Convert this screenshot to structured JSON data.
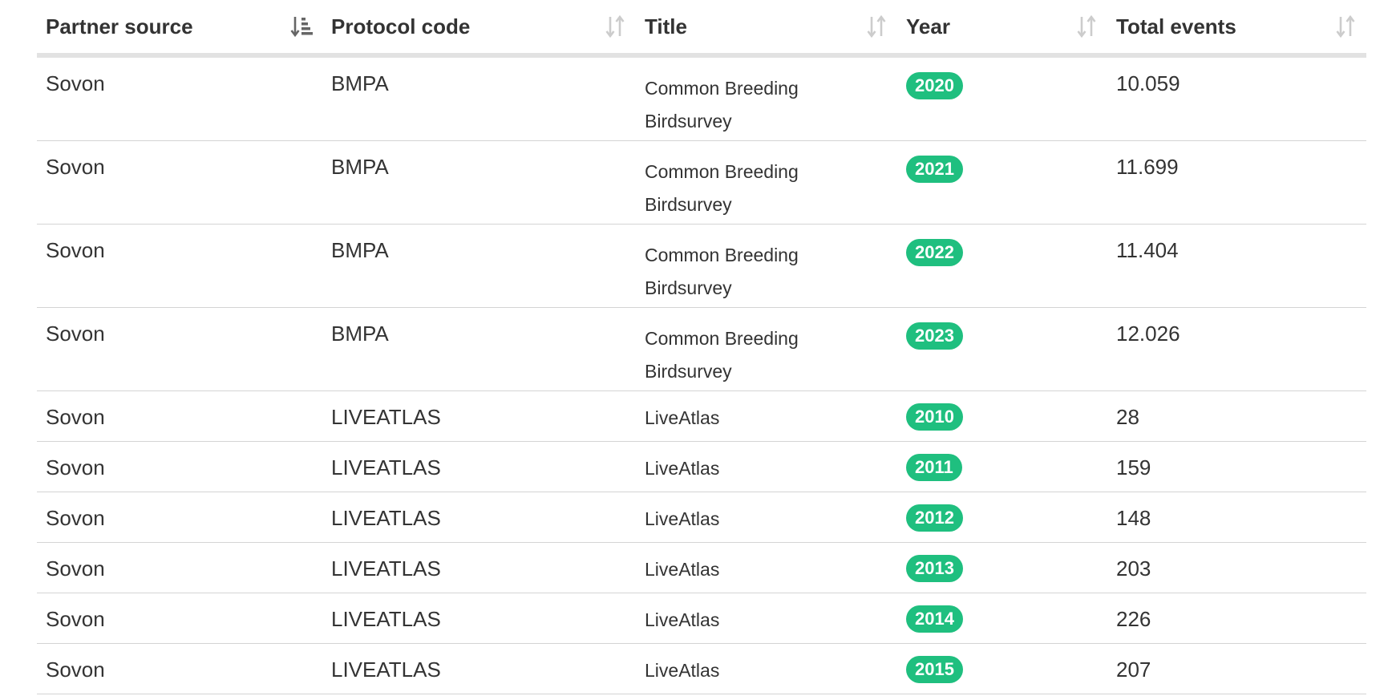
{
  "table": {
    "headers": [
      {
        "label": "Partner source",
        "sort": "active-sorted"
      },
      {
        "label": "Protocol code",
        "sort": "unsorted"
      },
      {
        "label": "Title",
        "sort": "unsorted"
      },
      {
        "label": "Year",
        "sort": "unsorted"
      },
      {
        "label": "Total events",
        "sort": "unsorted"
      }
    ],
    "rows": [
      {
        "partner": "Sovon",
        "protocol": "BMPA",
        "title": "Common Breeding Birdsurvey",
        "year": "2020",
        "events": "10.059"
      },
      {
        "partner": "Sovon",
        "protocol": "BMPA",
        "title": "Common Breeding Birdsurvey",
        "year": "2021",
        "events": "11.699"
      },
      {
        "partner": "Sovon",
        "protocol": "BMPA",
        "title": "Common Breeding Birdsurvey",
        "year": "2022",
        "events": "11.404"
      },
      {
        "partner": "Sovon",
        "protocol": "BMPA",
        "title": "Common Breeding Birdsurvey",
        "year": "2023",
        "events": "12.026"
      },
      {
        "partner": "Sovon",
        "protocol": "LIVEATLAS",
        "title": "LiveAtlas",
        "year": "2010",
        "events": "28"
      },
      {
        "partner": "Sovon",
        "protocol": "LIVEATLAS",
        "title": "LiveAtlas",
        "year": "2011",
        "events": "159"
      },
      {
        "partner": "Sovon",
        "protocol": "LIVEATLAS",
        "title": "LiveAtlas",
        "year": "2012",
        "events": "148"
      },
      {
        "partner": "Sovon",
        "protocol": "LIVEATLAS",
        "title": "LiveAtlas",
        "year": "2013",
        "events": "203"
      },
      {
        "partner": "Sovon",
        "protocol": "LIVEATLAS",
        "title": "LiveAtlas",
        "year": "2014",
        "events": "226"
      },
      {
        "partner": "Sovon",
        "protocol": "LIVEATLAS",
        "title": "LiveAtlas",
        "year": "2015",
        "events": "207"
      }
    ]
  },
  "colors": {
    "year_badge": "#1fbf7f",
    "header_rule": "#e2e2e2",
    "row_rule": "#d4d4d4",
    "sort_active": "#666666",
    "sort_inactive": "#cccccc"
  },
  "icons": {
    "active": "sort-amount-down-icon",
    "inactive": "sort-arrows-icon"
  }
}
